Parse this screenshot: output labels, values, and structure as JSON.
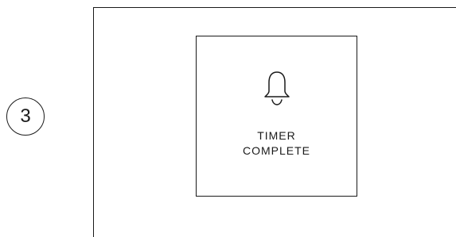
{
  "step": {
    "number": "3"
  },
  "notification": {
    "icon": "bell-icon",
    "line1": "TIMER",
    "line2": "COMPLETE"
  },
  "colors": {
    "stroke": "#1a1a1a",
    "background": "#ffffff"
  }
}
